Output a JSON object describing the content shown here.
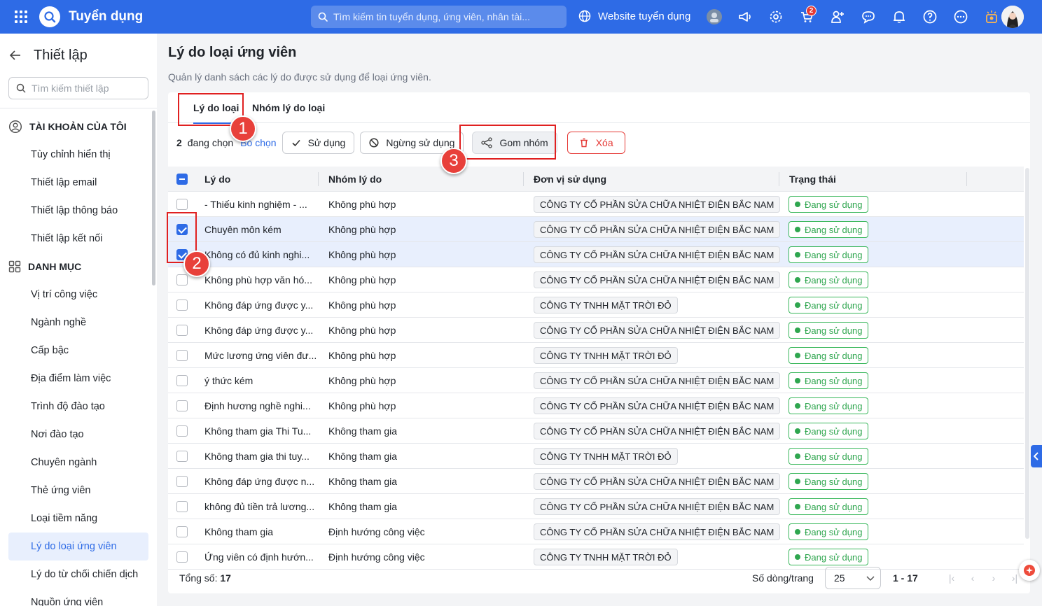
{
  "app": {
    "title": "Tuyển dụng",
    "brand_color": "#2e6be6"
  },
  "topbar": {
    "search_placeholder": "Tìm kiếm tin tuyển dụng, ứng viên, nhân tài...",
    "website_label": "Website tuyển dụng",
    "cart_badge": "2"
  },
  "sidebar": {
    "title": "Thiết lập",
    "search_placeholder": "Tìm kiếm thiết lập",
    "group_account": "TÀI KHOẢN CỦA TÔI",
    "account_items": [
      {
        "label": "Tùy chỉnh hiển thị"
      },
      {
        "label": "Thiết lập email"
      },
      {
        "label": "Thiết lập thông báo"
      },
      {
        "label": "Thiết lập kết nối"
      }
    ],
    "group_catalog": "DANH MỤC",
    "catalog_items": [
      {
        "label": "Vị trí công việc"
      },
      {
        "label": "Ngành nghề"
      },
      {
        "label": "Cấp bậc"
      },
      {
        "label": "Địa điểm làm việc"
      },
      {
        "label": "Trình độ đào tạo"
      },
      {
        "label": "Nơi đào tạo"
      },
      {
        "label": "Chuyên ngành"
      },
      {
        "label": "Thẻ ứng viên"
      },
      {
        "label": "Loại tiềm năng"
      },
      {
        "label": "Lý do loại ứng viên"
      },
      {
        "label": "Lý do từ chối chiến dịch"
      },
      {
        "label": "Nguồn ứng viên"
      }
    ]
  },
  "page": {
    "title": "Lý do loại ứng viên",
    "subtitle": "Quản lý danh sách các lý do được sử dụng để loại ứng viên."
  },
  "tabs": [
    {
      "label": "Lý do loại"
    },
    {
      "label": "Nhóm lý do loại"
    }
  ],
  "toolbar": {
    "selected_count": "2",
    "selected_text": "đang chọn",
    "unselect_label": "Bỏ chọn",
    "use_label": "Sử dụng",
    "stop_label": "Ngừng sử dụng",
    "group_label": "Gom nhóm",
    "delete_label": "Xóa"
  },
  "table": {
    "columns": [
      "Lý do",
      "Nhóm lý do",
      "Đơn vị sử dụng",
      "Trạng thái"
    ],
    "rows": [
      {
        "reason": "- Thiếu kinh nghiệm - ...",
        "group": "Không phù hợp",
        "company": "CÔNG TY CỔ PHẦN SỬA CHỮA NHIỆT ĐIỆN BẮC NAM",
        "status": "Đang sử dụng"
      },
      {
        "reason": "Chuyên môn kém",
        "group": "Không phù hợp",
        "company": "CÔNG TY CỔ PHẦN SỬA CHỮA NHIỆT ĐIỆN BẮC NAM",
        "status": "Đang sử dụng"
      },
      {
        "reason": "Không có đủ kinh nghi...",
        "group": "Không phù hợp",
        "company": "CÔNG TY CỔ PHẦN SỬA CHỮA NHIỆT ĐIỆN BẮC NAM",
        "status": "Đang sử dụng"
      },
      {
        "reason": "Không phù hợp văn hó...",
        "group": "Không phù hợp",
        "company": "CÔNG TY CỔ PHẦN SỬA CHỮA NHIỆT ĐIỆN BẮC NAM",
        "status": "Đang sử dụng"
      },
      {
        "reason": "Không đáp ứng được y...",
        "group": "Không phù hợp",
        "company": "CÔNG TY TNHH MẶT TRỜI ĐỎ",
        "status": "Đang sử dụng"
      },
      {
        "reason": "Không đáp ứng được y...",
        "group": "Không phù hợp",
        "company": "CÔNG TY CỔ PHẦN SỬA CHỮA NHIỆT ĐIỆN BẮC NAM",
        "status": "Đang sử dụng"
      },
      {
        "reason": "Mức lương ứng viên đư...",
        "group": "Không phù hợp",
        "company": "CÔNG TY TNHH MẶT TRỜI ĐỎ",
        "status": "Đang sử dụng"
      },
      {
        "reason": "ý thức kém",
        "group": "Không phù hợp",
        "company": "CÔNG TY CỔ PHẦN SỬA CHỮA NHIỆT ĐIỆN BẮC NAM",
        "status": "Đang sử dụng"
      },
      {
        "reason": "Định hương nghề nghi...",
        "group": "Không phù hợp",
        "company": "CÔNG TY CỔ PHẦN SỬA CHỮA NHIỆT ĐIỆN BẮC NAM",
        "status": "Đang sử dụng"
      },
      {
        "reason": "Không tham gia Thi Tu...",
        "group": "Không tham gia",
        "company": "CÔNG TY CỔ PHẦN SỬA CHỮA NHIỆT ĐIỆN BẮC NAM",
        "status": "Đang sử dụng"
      },
      {
        "reason": "Không tham gia thi tuy...",
        "group": "Không tham gia",
        "company": "CÔNG TY TNHH MẶT TRỜI ĐỎ",
        "status": "Đang sử dụng"
      },
      {
        "reason": "Không đáp ứng được n...",
        "group": "Không tham gia",
        "company": "CÔNG TY CỔ PHẦN SỬA CHỮA NHIỆT ĐIỆN BẮC NAM",
        "status": "Đang sử dụng"
      },
      {
        "reason": "không đủ tiền trả lương...",
        "group": "Không tham gia",
        "company": "CÔNG TY CỔ PHẦN SỬA CHỮA NHIỆT ĐIỆN BẮC NAM",
        "status": "Đang sử dụng"
      },
      {
        "reason": "Không tham gia",
        "group": "Định hướng công việc",
        "company": "CÔNG TY CỔ PHẦN SỬA CHỮA NHIỆT ĐIỆN BẮC NAM",
        "status": "Đang sử dụng"
      },
      {
        "reason": "Ứng viên có định hướn...",
        "group": "Định hướng công việc",
        "company": "CÔNG TY TNHH MẶT TRỜI ĐỎ",
        "status": "Đang sử dụng"
      }
    ],
    "selected_rows": [
      1,
      2
    ]
  },
  "footer": {
    "total_label": "Tổng số:",
    "total_value": "17",
    "rows_per_page_label": "Số dòng/trang",
    "rows_per_page": "25",
    "range": "1 - 17"
  },
  "annotations": {
    "n1": "1",
    "n2": "2",
    "n3": "3"
  }
}
